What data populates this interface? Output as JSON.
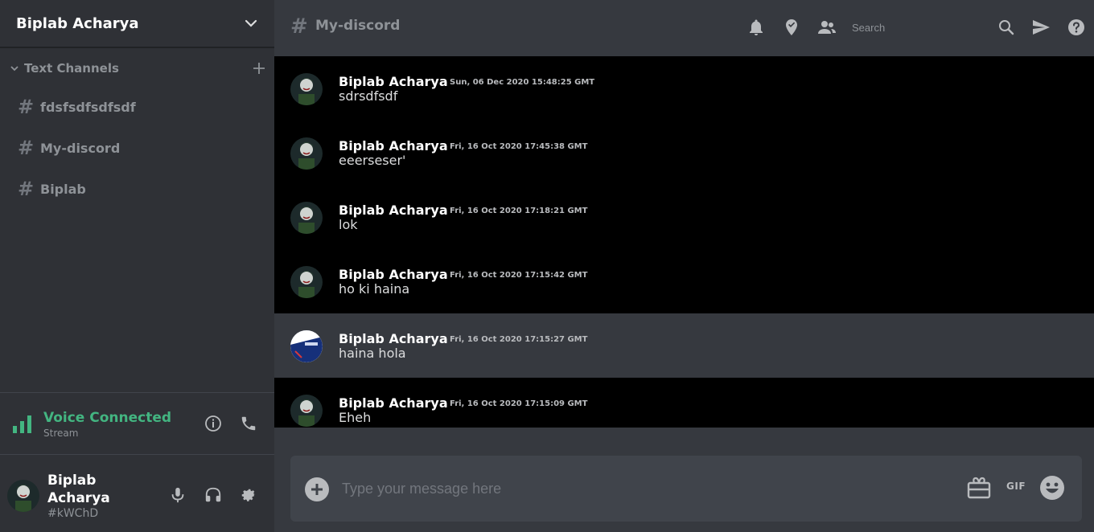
{
  "server": {
    "name": "Biplab Acharya"
  },
  "sidebar": {
    "channels_header": "Text Channels",
    "channels": [
      {
        "name": "fdsfsdfsdfsdf"
      },
      {
        "name": "My-discord"
      },
      {
        "name": "Biplab"
      }
    ]
  },
  "voice": {
    "title": "Voice Connected",
    "subtitle": "Stream",
    "color": "#43b581"
  },
  "user": {
    "name": "Biplab Acharya",
    "tag": "#kWChD"
  },
  "header": {
    "channel": "My-discord",
    "search_placeholder": "Search"
  },
  "messages": [
    {
      "author": "Biplab Acharya",
      "time": "Sun, 06 Dec 2020 15:48:25 GMT",
      "content": "sdrsdfsdf"
    },
    {
      "author": "Biplab Acharya",
      "time": "Fri, 16 Oct 2020 17:45:38 GMT",
      "content": "eeerseser'"
    },
    {
      "author": "Biplab Acharya",
      "time": "Fri, 16 Oct 2020 17:18:21 GMT",
      "content": "lok"
    },
    {
      "author": "Biplab Acharya",
      "time": "Fri, 16 Oct 2020 17:15:42 GMT",
      "content": "ho ki haina"
    },
    {
      "author": "Biplab Acharya",
      "time": "Fri, 16 Oct 2020 17:15:27 GMT",
      "content": "haina hola"
    },
    {
      "author": "Biplab Acharya",
      "time": "Fri, 16 Oct 2020 17:15:09 GMT",
      "content": "Eheh"
    }
  ],
  "composer": {
    "placeholder": "Type your message here",
    "gif_label": "GIF"
  }
}
